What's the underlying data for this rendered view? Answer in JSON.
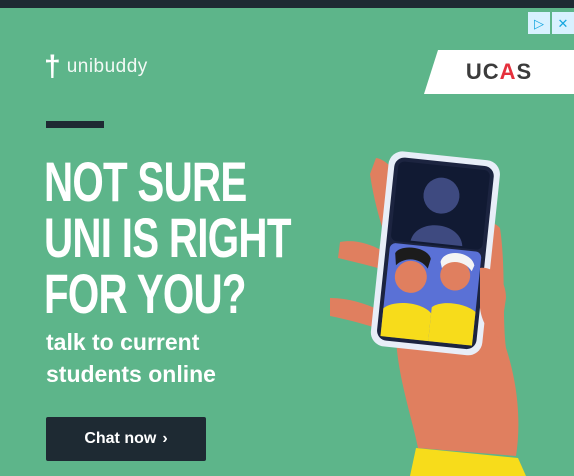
{
  "adchoices": {
    "info_glyph": "▷",
    "close_glyph": "✕"
  },
  "logo": {
    "mark": "†",
    "name": "unibuddy"
  },
  "partner": {
    "prefix": "UC",
    "accent": "A",
    "suffix": "S"
  },
  "headline": [
    "NOT SURE",
    "UNI IS RIGHT",
    "FOR YOU?"
  ],
  "subhead": [
    "talk to current",
    "students online"
  ],
  "cta": {
    "label": "Chat now",
    "arrow": "›"
  },
  "colors": {
    "background": "#5db58a",
    "dark": "#1e2a33",
    "ucas_accent": "#e5303c",
    "hand": "#e07f5f",
    "sleeve": "#f7dc1b"
  },
  "icons": [
    "adchoices-info-icon",
    "close-icon",
    "unibuddy-logo-icon",
    "chevron-right-icon"
  ]
}
